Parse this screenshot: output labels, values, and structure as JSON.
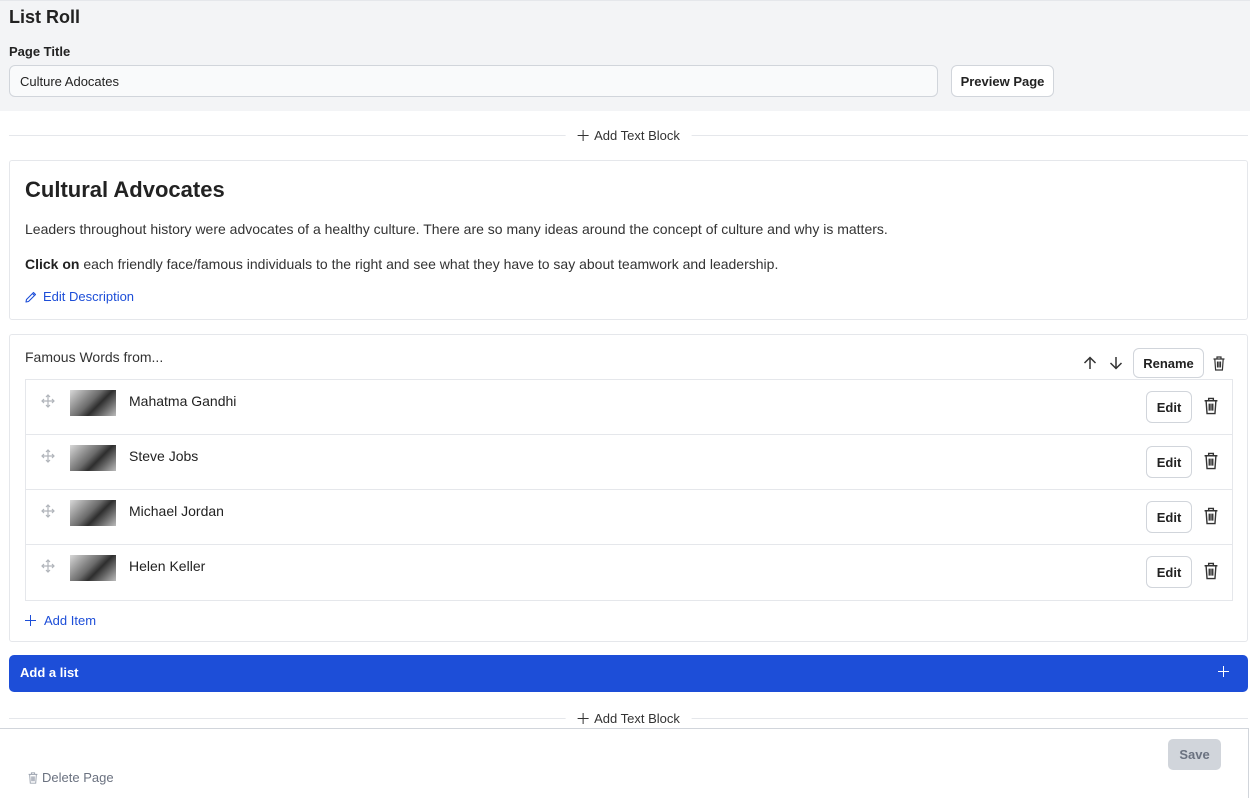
{
  "app": {
    "title": "List Roll"
  },
  "page_title": {
    "label": "Page Title",
    "value": "Culture Adocates",
    "preview_label": "Preview Page"
  },
  "add_text_block_label": "Add Text Block",
  "description": {
    "heading": "Cultural Advocates",
    "paragraph1": "Leaders throughout history were advocates of a healthy culture. There are so many ideas around the concept of culture and why is matters.",
    "paragraph2_bold": "Click on",
    "paragraph2_rest": " each friendly face/famous individuals to the right and see what they have to say about teamwork and leadership.",
    "edit_label": "Edit Description"
  },
  "list": {
    "name": "Famous Words from...",
    "rename_label": "Rename",
    "items": [
      {
        "name": "Mahatma Gandhi",
        "edit_label": "Edit"
      },
      {
        "name": "Steve Jobs",
        "edit_label": "Edit"
      },
      {
        "name": "Michael Jordan",
        "edit_label": "Edit"
      },
      {
        "name": "Helen Keller",
        "edit_label": "Edit"
      }
    ],
    "add_item_label": "Add Item"
  },
  "add_list": {
    "label": "Add a list"
  },
  "footer": {
    "save_label": "Save",
    "delete_label": "Delete Page"
  },
  "colors": {
    "accent": "#1d4ed8",
    "topbar_bg": "#f3f4f6",
    "border": "#e5e7eb"
  },
  "icons": [
    "plus-icon",
    "pencil-icon",
    "arrow-up-icon",
    "arrow-down-icon",
    "trash-icon",
    "drag-handle-icon"
  ]
}
